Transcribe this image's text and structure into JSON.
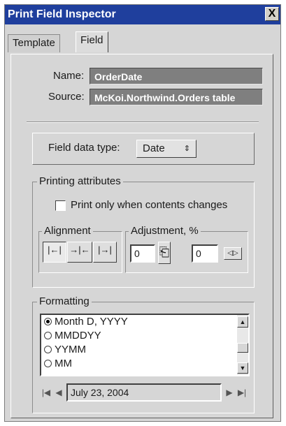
{
  "window": {
    "title": "Print Field Inspector",
    "close": "X"
  },
  "tabs": [
    {
      "label": "Template"
    },
    {
      "label": "Field"
    }
  ],
  "field": {
    "name_label": "Name:",
    "name_value": "OrderDate",
    "source_label": "Source:",
    "source_value": "McKoi.Northwind.Orders table",
    "data_type_label": "Field data type:",
    "data_type_value": "Date"
  },
  "printing": {
    "title": "Printing attributes",
    "print_only_changes": "Print only when contents changes",
    "alignment_title": "Alignment",
    "adjustment_title": "Adjustment, %",
    "adjust_left_value": "0",
    "adjust_right_value": "0",
    "alignment_selected": "left"
  },
  "formatting": {
    "title": "Formatting",
    "options": [
      "Month D, YYYY",
      "MMDDYY",
      "YYMM",
      "MM"
    ],
    "selected_index": 0,
    "preview": "July 23, 2004"
  }
}
